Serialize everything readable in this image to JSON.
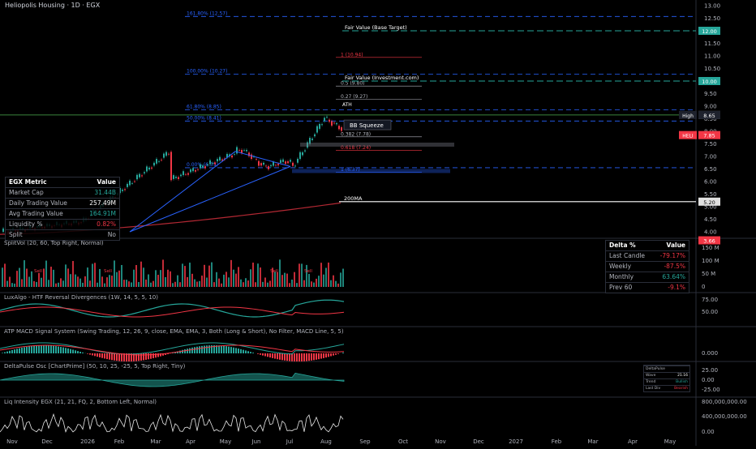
{
  "header": {
    "symbol_label": "Heliopolis Housing · 1D · EGX"
  },
  "price_axis": {
    "ticks": [
      "13.00",
      "12.50",
      "12.00",
      "11.50",
      "11.00",
      "10.50",
      "10.00",
      "9.50",
      "9.00",
      "8.50",
      "8.00",
      "7.50",
      "7.00",
      "6.50",
      "6.00",
      "5.50",
      "5.00",
      "4.50",
      "4.00"
    ]
  },
  "price_tags": [
    {
      "text": "12.00",
      "color": "#26a69a",
      "value": 12.0
    },
    {
      "text": "10.00",
      "color": "#26a69a",
      "value": 10.0
    },
    {
      "text": "8.65",
      "color": "#787b86",
      "value": 8.65
    },
    {
      "text": "8.65",
      "color": "#1e222d",
      "value": 8.65,
      "label": "High"
    },
    {
      "text": "7.85",
      "color": "#f23645",
      "value": 7.85,
      "label": "HELI"
    },
    {
      "text": "5.20",
      "color": "#e0e0e0",
      "value": 5.2
    },
    {
      "text": "3.66",
      "color": "#f23645",
      "value": 3.66
    }
  ],
  "time_axis": {
    "labels": [
      "Nov",
      "Dec",
      "2026",
      "Feb",
      "Mar",
      "Apr",
      "May",
      "Jun",
      "Jul",
      "Aug",
      "Sep",
      "Oct",
      "Nov",
      "Dec",
      "2027",
      "Feb",
      "Mar",
      "Apr",
      "May"
    ]
  },
  "chart_data": {
    "type": "candlestick",
    "y_range": [
      4.0,
      13.0
    ],
    "fib_levels": [
      {
        "label": "161.80% (12.57)",
        "value": 12.57,
        "color": "#2962ff"
      },
      {
        "label": "100.00% (10.27)",
        "value": 10.27,
        "color": "#2962ff"
      },
      {
        "label": "61.80% (8.85)",
        "value": 8.85,
        "color": "#2962ff"
      },
      {
        "label": "50.00% (8.41)",
        "value": 8.41,
        "color": "#2962ff"
      },
      {
        "label": "0.00% (6.55)",
        "value": 6.55,
        "color": "#2962ff"
      }
    ],
    "fib_retrace": [
      {
        "label": "1 (10.94)",
        "value": 10.94,
        "color": "#f23645"
      },
      {
        "label": "0.5 (9.80)",
        "value": 9.8,
        "color": "#b2b5be"
      },
      {
        "label": "0.27 (9.27)",
        "value": 9.27,
        "color": "#b2b5be"
      },
      {
        "label": "0.382 (7.78)",
        "value": 7.78,
        "color": "#b2b5be"
      },
      {
        "label": "0.618 (7.24)",
        "value": 7.24,
        "color": "#f23645"
      },
      {
        "label": "1 (6.37)",
        "value": 6.37,
        "color": "#2962ff"
      }
    ],
    "fair_values": [
      {
        "label": "Fair Value (Base Target)",
        "value": 12.0
      },
      {
        "label": "Fair Value (Investment.com)",
        "value": 10.0
      }
    ],
    "annotations": {
      "ath": "ATH",
      "bb_squeeze": "BB Squeeze",
      "ma200": "200MA"
    },
    "ma200_value": 5.2,
    "high_value": 8.65,
    "last_value": 7.85
  },
  "egx_metric": {
    "header": [
      "EGX Metric",
      "Value"
    ],
    "rows": [
      {
        "label": "Market Cap",
        "value": "31.44B",
        "color": "#26a69a"
      },
      {
        "label": "Daily Trading Value",
        "value": "257.49M",
        "color": "#fff"
      },
      {
        "label": "Avg Trading Value",
        "value": "164.91M",
        "color": "#26a69a"
      },
      {
        "label": "Liquidity %",
        "value": "0.82%",
        "color": "#f23645"
      },
      {
        "label": "Split",
        "value": "No",
        "color": "#b2b5be"
      }
    ]
  },
  "delta_table": {
    "header": [
      "Delta %",
      "Value"
    ],
    "rows": [
      {
        "label": "Last Candle",
        "value": "-79.17%"
      },
      {
        "label": "Weekly",
        "value": "-87.5%"
      },
      {
        "label": "Monthly",
        "value": "63.64%"
      },
      {
        "label": "Prev 60",
        "value": "-9.1%"
      }
    ]
  },
  "panes": [
    {
      "title": "SplitVol (20, 60, Top Right, Normal)",
      "ticks": [
        "150 M",
        "100 M",
        "50 M",
        "0"
      ]
    },
    {
      "title": "LuxAlgo - HTF Reversal Divergences (1W, 14, 5, 5, 10)",
      "ticks": [
        "75.00",
        "50.00"
      ]
    },
    {
      "title": "ATP MACD Signal System (Swing Trading, 12, 26, 9, close, EMA, EMA, 3, Both (Long & Short), No Filter, MACD Line, 5, 5)",
      "ticks": [
        "0.000"
      ]
    },
    {
      "title": "DeltaPulse Osc [ChartPrime] (50, 10, 25, -25, 5, Top Right, Tiny)",
      "ticks": [
        "25.00",
        "0.00",
        "-25.00"
      ]
    },
    {
      "title": "Liq Intensity EGX (21, 21, FQ, 2, Bottom Left, Normal)",
      "ticks": [
        "800,000,000.00",
        "400,000,000.00",
        "0.00"
      ]
    }
  ],
  "mini_table": {
    "rows": [
      [
        "DeltaPulse",
        ""
      ],
      [
        "Wave",
        "21.16"
      ],
      [
        "Trend",
        "Bullish"
      ],
      [
        "Last Div",
        "Bearish"
      ]
    ]
  },
  "sell_labels": [
    "Sell",
    "Sell",
    "Sell",
    "Sell"
  ]
}
